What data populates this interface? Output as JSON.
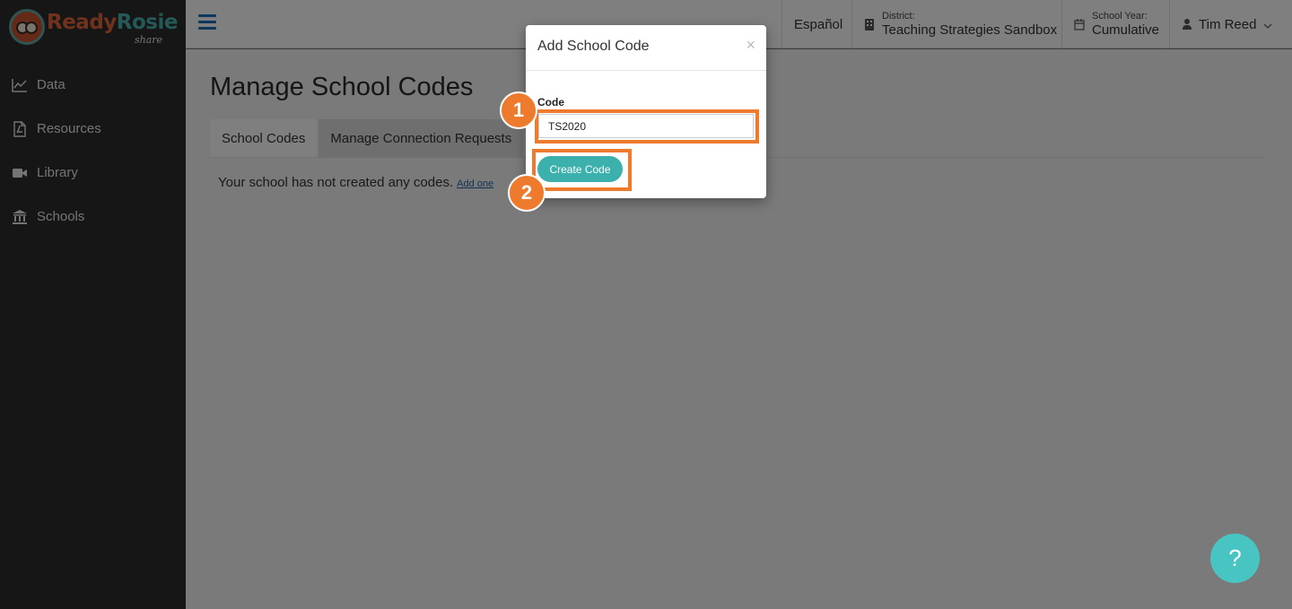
{
  "brand": {
    "name_part1": "Ready",
    "name_part2": "Rosie",
    "sub": "share",
    "color_ready": "#e2653a",
    "color_rosie": "#4ab3b0"
  },
  "sidebar": {
    "items": [
      {
        "label": "Data",
        "icon": "line-chart-icon"
      },
      {
        "label": "Resources",
        "icon": "pdf-file-icon"
      },
      {
        "label": "Library",
        "icon": "video-camera-icon"
      },
      {
        "label": "Schools",
        "icon": "bank-building-icon"
      }
    ]
  },
  "topbar": {
    "language": "Español",
    "district_label": "District:",
    "district_value": "Teaching Strategies Sandbox",
    "year_label": "School Year:",
    "year_value": "Cumulative",
    "user_name": "Tim Reed"
  },
  "main": {
    "title": "Manage School Codes",
    "tabs": [
      {
        "label": "School Codes",
        "active": true
      },
      {
        "label": "Manage Connection Requests",
        "active": false
      }
    ],
    "empty_message": "Your school has not created any codes.",
    "add_link": "Add one"
  },
  "modal": {
    "title": "Add School Code",
    "close_glyph": "×",
    "field_label": "Code",
    "code_value": "TS2020",
    "submit_label": "Create Code"
  },
  "annotations": {
    "step1": "1",
    "step2": "2",
    "color": "#ee7a2e"
  },
  "help": {
    "glyph": "?"
  },
  "colors": {
    "teal": "#3cb0ac",
    "sidebar": "#2c2c2c",
    "hamburger": "#1f6fb2"
  }
}
